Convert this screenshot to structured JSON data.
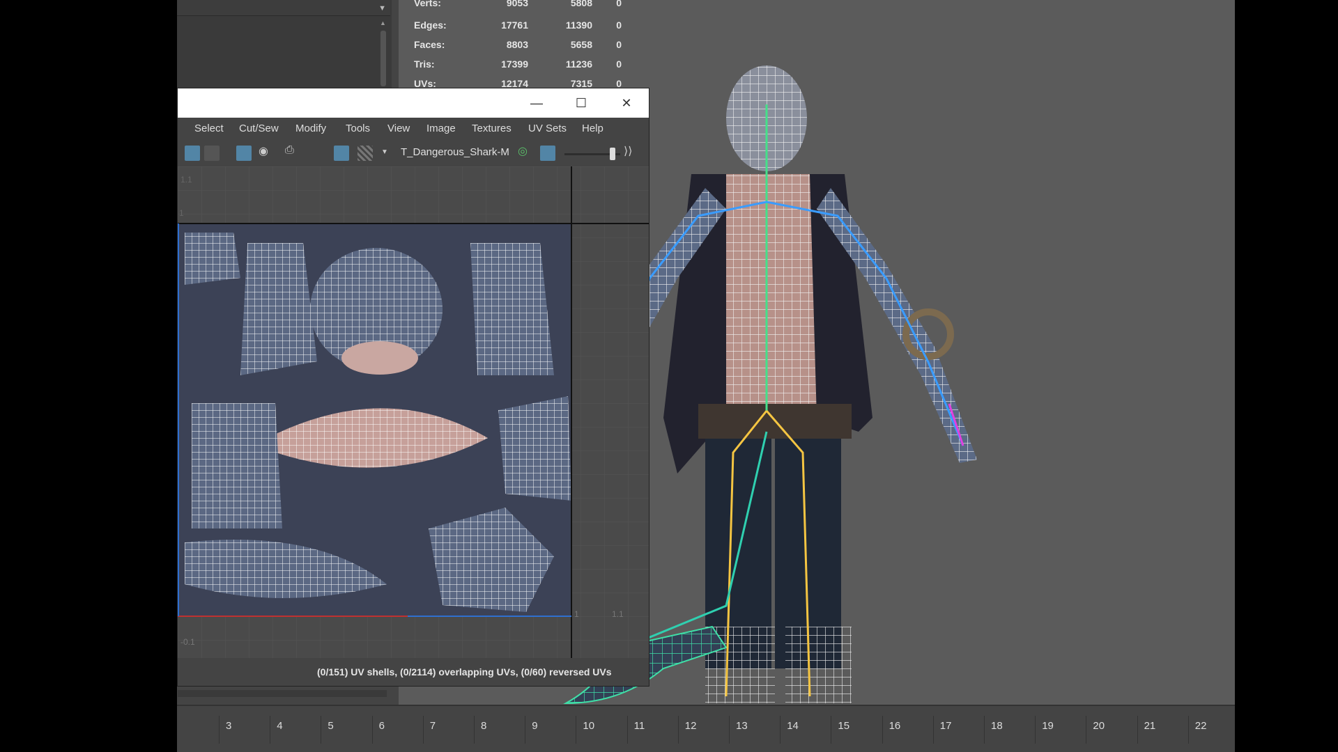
{
  "hud": {
    "rows": [
      {
        "label": "Verts:",
        "v1": "9053",
        "v2": "5808",
        "v3": "0"
      },
      {
        "label": "Edges:",
        "v1": "17761",
        "v2": "11390",
        "v3": "0"
      },
      {
        "label": "Faces:",
        "v1": "8803",
        "v2": "5658",
        "v3": "0"
      },
      {
        "label": "Tris:",
        "v1": "17399",
        "v2": "11236",
        "v3": "0"
      },
      {
        "label": "UVs:",
        "v1": "12174",
        "v2": "7315",
        "v3": "0"
      }
    ]
  },
  "uv_editor": {
    "window_buttons": {
      "minimize": "—",
      "maximize": "☐",
      "close": "✕"
    },
    "menu": [
      "Select",
      "Cut/Sew",
      "Modify",
      "Tools",
      "View",
      "Image",
      "Textures",
      "UV Sets",
      "Help"
    ],
    "texture_name": "T_Dangerous_Shark-M",
    "axis_labels": {
      "top_left": "1.1",
      "top_left_2": "1",
      "bottom_left": "-0.1",
      "right_1": "1",
      "right_2": "1.1"
    },
    "status": "(0/151) UV shells, (0/2114) overlapping UVs, (0/60) reversed UVs"
  },
  "timeline": {
    "ticks": [
      "3",
      "4",
      "5",
      "6",
      "7",
      "8",
      "9",
      "10",
      "11",
      "12",
      "13",
      "14",
      "15",
      "16",
      "17",
      "18",
      "19",
      "20",
      "21",
      "22"
    ]
  },
  "colors": {
    "viewport_bg": "#5b5b5b",
    "panel_bg": "#444444",
    "accent": "#5285a6"
  }
}
